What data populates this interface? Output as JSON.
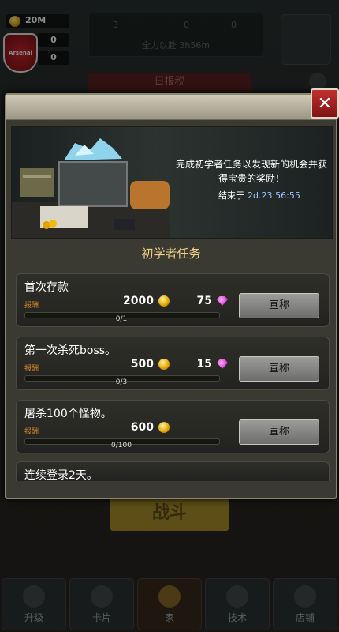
{
  "hud": {
    "coins": "20M",
    "stat1": "0",
    "stat2": "0",
    "team_badge": "Arsenal",
    "panel": {
      "a": "3",
      "b": "0",
      "c": "0",
      "timer": "全力以赴 3h56m"
    },
    "red_tab": "日报税"
  },
  "dialog": {
    "banner": {
      "description": "完成初学者任务以发现新的机会并获得宝贵的奖励！",
      "end_label": "结束于",
      "end_time": "2d.23:56:55"
    },
    "section_title": "初学者任务",
    "reward_label": "报酬",
    "claim_label": "宣称",
    "tasks": [
      {
        "title": "首次存款",
        "coins": "2000",
        "gems": "75",
        "progress_text": "0/1",
        "progress": 0
      },
      {
        "title": "第一次杀死boss。",
        "coins": "500",
        "gems": "15",
        "progress_text": "0/3",
        "progress": 0
      },
      {
        "title": "屠杀100个怪物。",
        "coins": "600",
        "gems": "",
        "progress_text": "0/100",
        "progress": 0
      },
      {
        "title": "连续登录2天。",
        "coins": "",
        "gems": "",
        "progress_text": "",
        "progress": 0
      }
    ]
  },
  "battle_label": "战斗",
  "nav": [
    {
      "label": "升级",
      "icon": "wrench-hammer-icon"
    },
    {
      "label": "卡片",
      "icon": "lock-icon"
    },
    {
      "label": "家",
      "icon": "star-wings-icon"
    },
    {
      "label": "技术",
      "icon": "lock-icon"
    },
    {
      "label": "店铺",
      "icon": "cart-icon"
    }
  ]
}
